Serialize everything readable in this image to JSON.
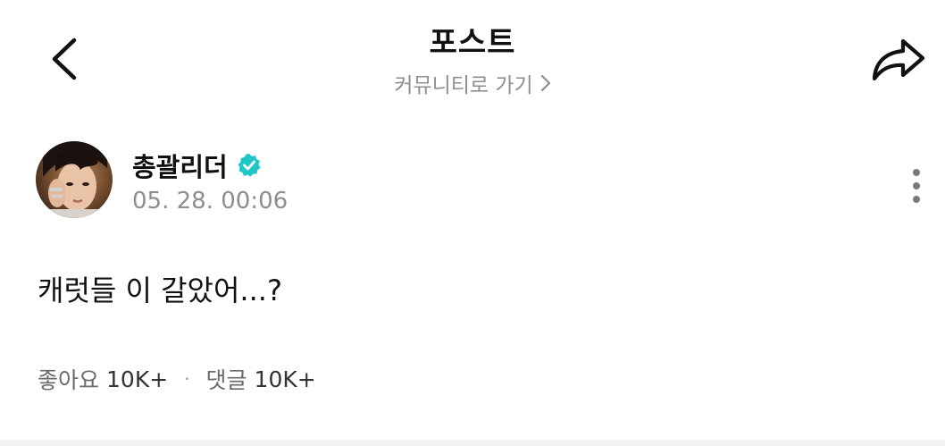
{
  "header": {
    "title": "포스트",
    "community_link": "커뮤니티로 가기"
  },
  "author": {
    "name": "총괄리더",
    "verified": true,
    "timestamp": "05. 28. 00:06"
  },
  "post": {
    "text": "캐럿들 이 갈았어...?"
  },
  "stats": {
    "likes_label": "좋아요",
    "likes_count": "10K+",
    "separator": "·",
    "comments_label": "댓글",
    "comments_count": "10K+"
  },
  "colors": {
    "verified_badge": "#1fc7c7",
    "muted_text": "#8e8e8e"
  },
  "icons": {
    "back": "chevron-left-icon",
    "share": "share-arrow-icon",
    "community": "chevron-right-icon",
    "verified": "verified-badge-icon",
    "more": "more-vertical-icon"
  }
}
